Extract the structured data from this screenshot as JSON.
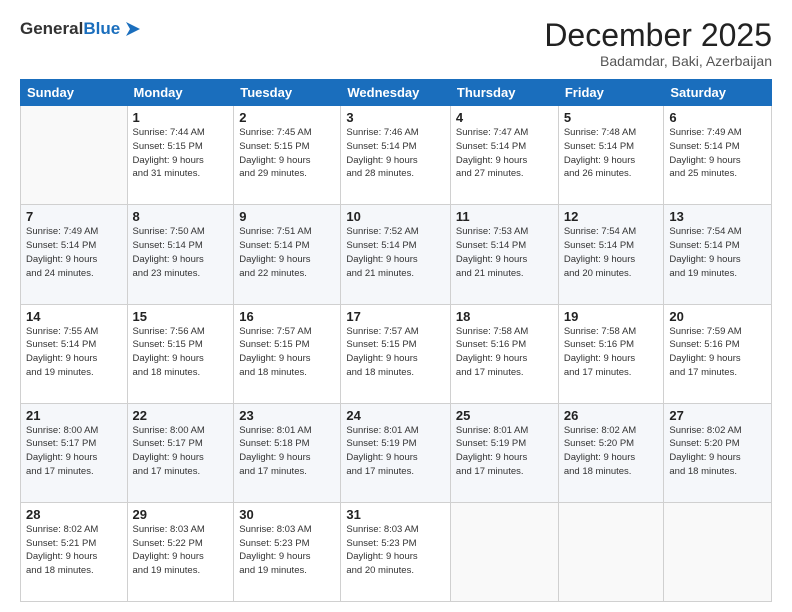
{
  "header": {
    "logo_general": "General",
    "logo_blue": "Blue",
    "month_title": "December 2025",
    "location": "Badamdar, Baki, Azerbaijan"
  },
  "weekdays": [
    "Sunday",
    "Monday",
    "Tuesday",
    "Wednesday",
    "Thursday",
    "Friday",
    "Saturday"
  ],
  "weeks": [
    [
      {
        "day": "",
        "info": ""
      },
      {
        "day": "1",
        "info": "Sunrise: 7:44 AM\nSunset: 5:15 PM\nDaylight: 9 hours\nand 31 minutes."
      },
      {
        "day": "2",
        "info": "Sunrise: 7:45 AM\nSunset: 5:15 PM\nDaylight: 9 hours\nand 29 minutes."
      },
      {
        "day": "3",
        "info": "Sunrise: 7:46 AM\nSunset: 5:14 PM\nDaylight: 9 hours\nand 28 minutes."
      },
      {
        "day": "4",
        "info": "Sunrise: 7:47 AM\nSunset: 5:14 PM\nDaylight: 9 hours\nand 27 minutes."
      },
      {
        "day": "5",
        "info": "Sunrise: 7:48 AM\nSunset: 5:14 PM\nDaylight: 9 hours\nand 26 minutes."
      },
      {
        "day": "6",
        "info": "Sunrise: 7:49 AM\nSunset: 5:14 PM\nDaylight: 9 hours\nand 25 minutes."
      }
    ],
    [
      {
        "day": "7",
        "info": "Sunrise: 7:49 AM\nSunset: 5:14 PM\nDaylight: 9 hours\nand 24 minutes."
      },
      {
        "day": "8",
        "info": "Sunrise: 7:50 AM\nSunset: 5:14 PM\nDaylight: 9 hours\nand 23 minutes."
      },
      {
        "day": "9",
        "info": "Sunrise: 7:51 AM\nSunset: 5:14 PM\nDaylight: 9 hours\nand 22 minutes."
      },
      {
        "day": "10",
        "info": "Sunrise: 7:52 AM\nSunset: 5:14 PM\nDaylight: 9 hours\nand 21 minutes."
      },
      {
        "day": "11",
        "info": "Sunrise: 7:53 AM\nSunset: 5:14 PM\nDaylight: 9 hours\nand 21 minutes."
      },
      {
        "day": "12",
        "info": "Sunrise: 7:54 AM\nSunset: 5:14 PM\nDaylight: 9 hours\nand 20 minutes."
      },
      {
        "day": "13",
        "info": "Sunrise: 7:54 AM\nSunset: 5:14 PM\nDaylight: 9 hours\nand 19 minutes."
      }
    ],
    [
      {
        "day": "14",
        "info": "Sunrise: 7:55 AM\nSunset: 5:14 PM\nDaylight: 9 hours\nand 19 minutes."
      },
      {
        "day": "15",
        "info": "Sunrise: 7:56 AM\nSunset: 5:15 PM\nDaylight: 9 hours\nand 18 minutes."
      },
      {
        "day": "16",
        "info": "Sunrise: 7:57 AM\nSunset: 5:15 PM\nDaylight: 9 hours\nand 18 minutes."
      },
      {
        "day": "17",
        "info": "Sunrise: 7:57 AM\nSunset: 5:15 PM\nDaylight: 9 hours\nand 18 minutes."
      },
      {
        "day": "18",
        "info": "Sunrise: 7:58 AM\nSunset: 5:16 PM\nDaylight: 9 hours\nand 17 minutes."
      },
      {
        "day": "19",
        "info": "Sunrise: 7:58 AM\nSunset: 5:16 PM\nDaylight: 9 hours\nand 17 minutes."
      },
      {
        "day": "20",
        "info": "Sunrise: 7:59 AM\nSunset: 5:16 PM\nDaylight: 9 hours\nand 17 minutes."
      }
    ],
    [
      {
        "day": "21",
        "info": "Sunrise: 8:00 AM\nSunset: 5:17 PM\nDaylight: 9 hours\nand 17 minutes."
      },
      {
        "day": "22",
        "info": "Sunrise: 8:00 AM\nSunset: 5:17 PM\nDaylight: 9 hours\nand 17 minutes."
      },
      {
        "day": "23",
        "info": "Sunrise: 8:01 AM\nSunset: 5:18 PM\nDaylight: 9 hours\nand 17 minutes."
      },
      {
        "day": "24",
        "info": "Sunrise: 8:01 AM\nSunset: 5:19 PM\nDaylight: 9 hours\nand 17 minutes."
      },
      {
        "day": "25",
        "info": "Sunrise: 8:01 AM\nSunset: 5:19 PM\nDaylight: 9 hours\nand 17 minutes."
      },
      {
        "day": "26",
        "info": "Sunrise: 8:02 AM\nSunset: 5:20 PM\nDaylight: 9 hours\nand 18 minutes."
      },
      {
        "day": "27",
        "info": "Sunrise: 8:02 AM\nSunset: 5:20 PM\nDaylight: 9 hours\nand 18 minutes."
      }
    ],
    [
      {
        "day": "28",
        "info": "Sunrise: 8:02 AM\nSunset: 5:21 PM\nDaylight: 9 hours\nand 18 minutes."
      },
      {
        "day": "29",
        "info": "Sunrise: 8:03 AM\nSunset: 5:22 PM\nDaylight: 9 hours\nand 19 minutes."
      },
      {
        "day": "30",
        "info": "Sunrise: 8:03 AM\nSunset: 5:23 PM\nDaylight: 9 hours\nand 19 minutes."
      },
      {
        "day": "31",
        "info": "Sunrise: 8:03 AM\nSunset: 5:23 PM\nDaylight: 9 hours\nand 20 minutes."
      },
      {
        "day": "",
        "info": ""
      },
      {
        "day": "",
        "info": ""
      },
      {
        "day": "",
        "info": ""
      }
    ]
  ]
}
